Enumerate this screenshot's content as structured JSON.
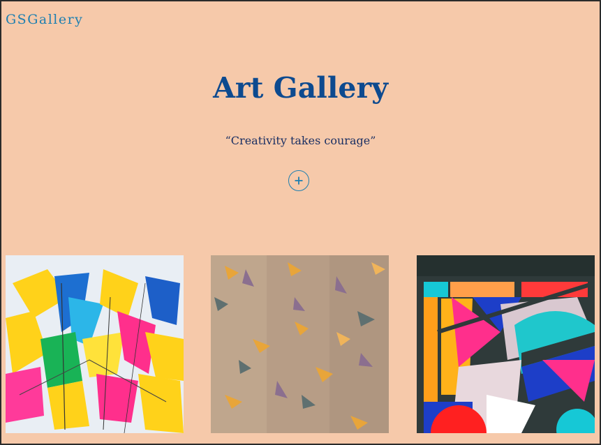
{
  "header": {
    "brand": "GSGallery"
  },
  "hero": {
    "title": "Art Gallery",
    "quote": "“Creativity takes courage”",
    "add_icon": "plus-circle-icon"
  },
  "gallery": {
    "items": [
      {
        "description": "abstract-paint-splash"
      },
      {
        "description": "hanging-paper-birds"
      },
      {
        "description": "geometric-mural"
      }
    ]
  },
  "colors": {
    "background": "#f6c9aa",
    "brand": "#1e7fb0",
    "title": "#0d4a8f",
    "quote": "#1a2f63"
  }
}
